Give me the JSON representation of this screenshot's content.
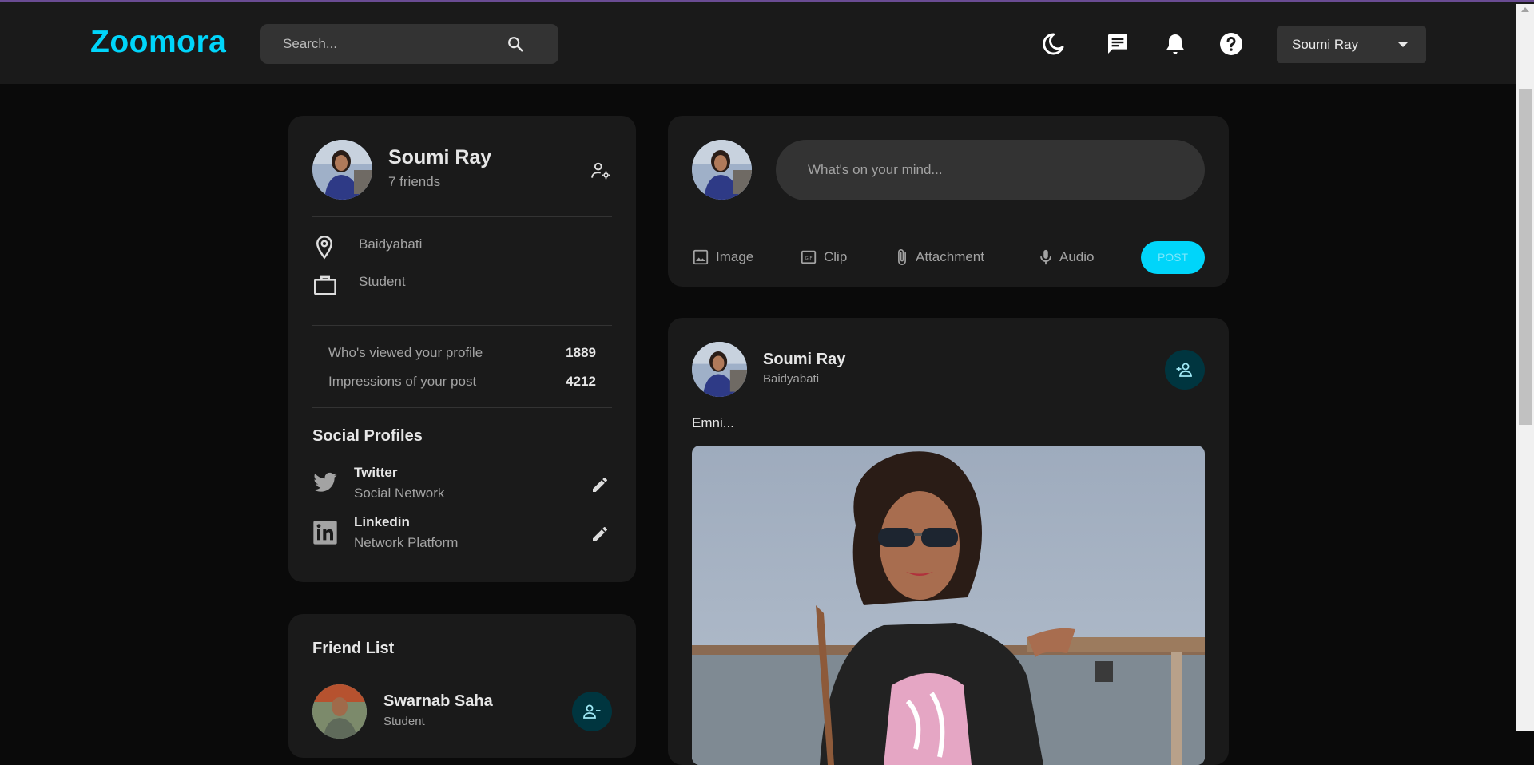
{
  "app": {
    "logo": "Zoomora"
  },
  "header": {
    "search_placeholder": "Search...",
    "user_name": "Soumi Ray",
    "icons": [
      "moon-icon",
      "message-icon",
      "bell-icon",
      "help-icon",
      "search-icon"
    ]
  },
  "colors": {
    "accent": "#00d5fa",
    "card": "#1a1a1a",
    "background": "#0a0a0a",
    "muted": "#a3a3a3"
  },
  "profile": {
    "name": "Soumi Ray",
    "friends": "7 friends",
    "location": "Baidyabati",
    "occupation": "Student",
    "stats": [
      {
        "label": "Who's viewed your profile",
        "value": "1889"
      },
      {
        "label": "Impressions of your post",
        "value": "4212"
      }
    ],
    "social_title": "Social Profiles",
    "social": [
      {
        "name": "Twitter",
        "desc": "Social Network",
        "icon": "twitter-icon"
      },
      {
        "name": "Linkedin",
        "desc": "Network Platform",
        "icon": "linkedin-icon"
      }
    ]
  },
  "friend_list": {
    "title": "Friend List",
    "friends": [
      {
        "name": "Swarnab Saha",
        "subtitle": "Student"
      }
    ]
  },
  "composer": {
    "placeholder": "What's on your mind...",
    "actions": [
      {
        "label": "Image",
        "icon": "image-icon"
      },
      {
        "label": "Clip",
        "icon": "gif-icon"
      },
      {
        "label": "Attachment",
        "icon": "paperclip-icon"
      },
      {
        "label": "Audio",
        "icon": "mic-icon"
      }
    ],
    "post_label": "POST"
  },
  "post": {
    "author": "Soumi Ray",
    "location": "Baidyabati",
    "text": "Emni..."
  }
}
